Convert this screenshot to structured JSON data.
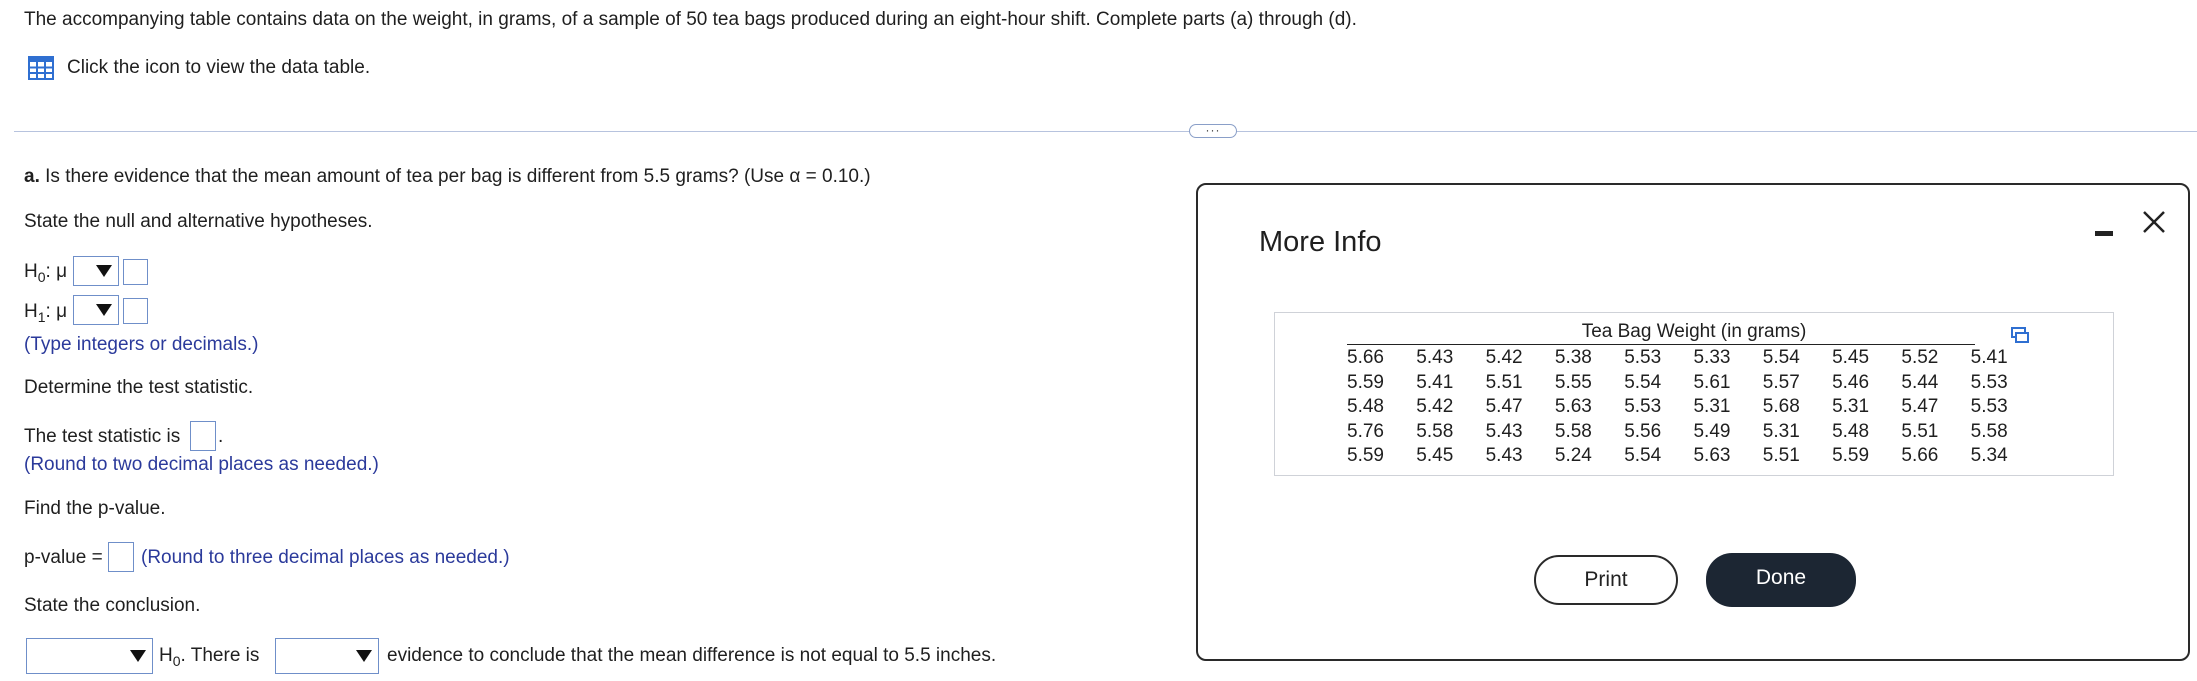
{
  "intro": {
    "text": "The accompanying table contains data on the weight, in grams, of a sample of 50 tea bags produced during an eight-hour shift. Complete parts (a) through (d).",
    "data_link": "Click the icon to view the data table.",
    "icon": "table-grid-icon"
  },
  "divider": {
    "dots_label": "···"
  },
  "question_a": {
    "label_bold": "a.",
    "text": "Is there evidence that the mean amount of tea per bag is different from 5.5 grams? (Use α = 0.10.)",
    "hyp_prompt": "State the null and alternative hypotheses.",
    "h0_label": "H",
    "h0_sub": "0",
    "h0_mu": ": μ",
    "h1_label": "H",
    "h1_sub": "1",
    "h1_mu": ": μ",
    "hyp_hint": "(Type integers or decimals.)",
    "test_stat_prompt": "Determine the test statistic.",
    "test_stat_label": "The test statistic is",
    "test_stat_period": ".",
    "test_stat_hint": "(Round to two decimal places as needed.)",
    "pvalue_prompt": "Find the p-value.",
    "pvalue_label": "p-value =",
    "pvalue_hint": "(Round to three decimal places as needed.)",
    "conclusion_prompt": "State the conclusion.",
    "conclusion_h_label": "H",
    "conclusion_h_sub": "0",
    "conclusion_mid": ". There is",
    "conclusion_end": "evidence to conclude that the mean difference is not equal to 5.5 inches."
  },
  "dialog": {
    "title": "More Info",
    "minimize_icon": "minimize-icon",
    "close_icon": "close-icon",
    "copy_icon": "copy-icon",
    "table_caption": "Tea Bag Weight (in grams)",
    "rows": [
      [
        "5.66",
        "5.43",
        "5.42",
        "5.38",
        "5.53",
        "5.33",
        "5.54",
        "5.45",
        "5.52",
        "5.41"
      ],
      [
        "5.59",
        "5.41",
        "5.51",
        "5.55",
        "5.54",
        "5.61",
        "5.57",
        "5.46",
        "5.44",
        "5.53"
      ],
      [
        "5.48",
        "5.42",
        "5.47",
        "5.63",
        "5.53",
        "5.31",
        "5.68",
        "5.31",
        "5.47",
        "5.53"
      ],
      [
        "5.76",
        "5.58",
        "5.43",
        "5.58",
        "5.56",
        "5.49",
        "5.31",
        "5.48",
        "5.51",
        "5.58"
      ],
      [
        "5.59",
        "5.45",
        "5.43",
        "5.24",
        "5.54",
        "5.63",
        "5.51",
        "5.59",
        "5.66",
        "5.34"
      ]
    ],
    "print_label": "Print",
    "done_label": "Done"
  },
  "colors": {
    "hint_blue": "#2b3a9b",
    "input_border": "#6f8fc9",
    "done_bg": "#1c2633"
  }
}
